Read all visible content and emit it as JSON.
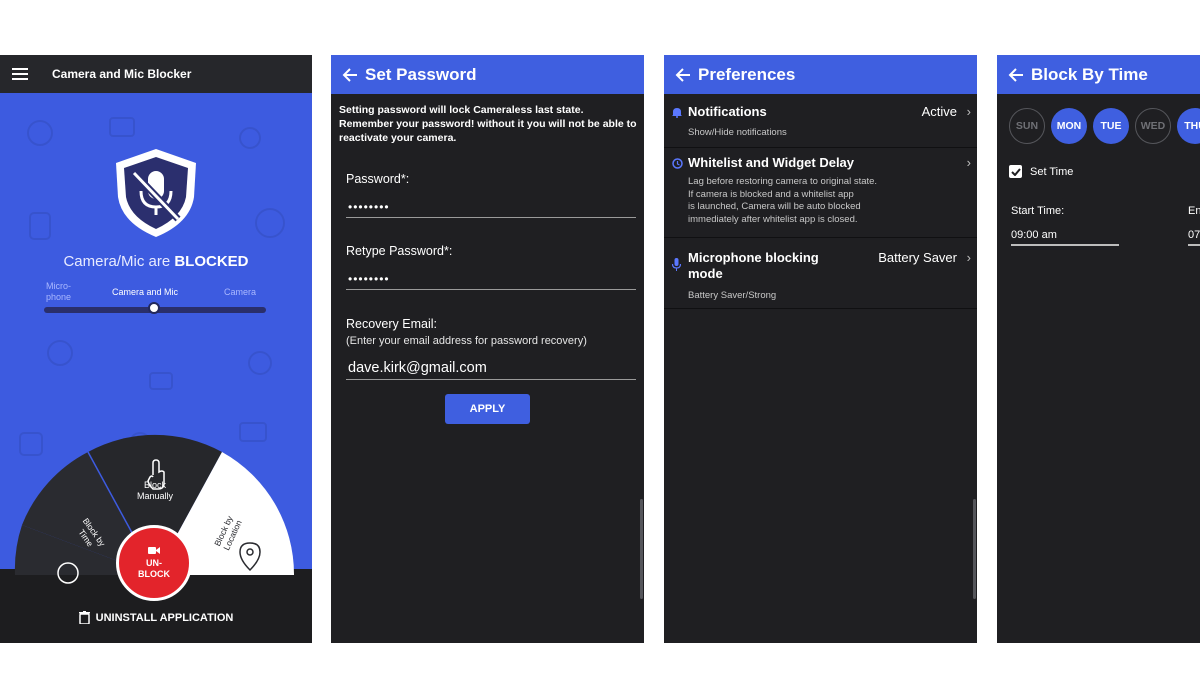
{
  "screen1": {
    "title": "Camera and Mic Blocker",
    "status_prefix": "Camera/Mic are",
    "status_state": "BLOCKED",
    "modes": [
      "Micro-\nphone",
      "Camera and Mic",
      "Camera"
    ],
    "selected_mode": "Camera and Mic",
    "wheel": {
      "block_manually": "Block\nManually",
      "block_by_time": "Block by\nTime",
      "block_by_location": "Block by\nLocation"
    },
    "unblock_label": "UN-\nBLOCK",
    "uninstall_label": "UNINSTALL APPLICATION",
    "colors": {
      "accent": "#3d5be0",
      "danger": "#e3242b",
      "dark": "#26272b"
    }
  },
  "screen2": {
    "title": "Set Password",
    "intro": "Setting password will lock Cameraless last state. Remember your password! without it you will not be able to reactivate your camera.",
    "password_label": "Password*:",
    "password_value": "••••••••",
    "retype_label": "Retype Password*:",
    "retype_value": "••••••••",
    "email_label": "Recovery Email:",
    "email_hint": "(Enter your email address for password recovery)",
    "email_value": "dave.kirk@gmail.com",
    "apply_label": "APPLY"
  },
  "screen3": {
    "title": "Preferences",
    "items": [
      {
        "title": "Notifications",
        "desc": "Show/Hide notifications",
        "value": "Active",
        "icon": "bell-icon"
      },
      {
        "title": "Whitelist and Widget Delay",
        "desc": "Lag before restoring camera to original state.\nIf camera is blocked and a whitelist app\nis launched, Camera will be auto blocked\nimmediately after whitelist app is closed.",
        "value": "",
        "icon": "clock-icon"
      },
      {
        "title": "Microphone blocking\nmode",
        "desc": "Battery Saver/Strong",
        "value": "Battery Saver",
        "icon": "mic-icon"
      }
    ]
  },
  "screen4": {
    "title": "Block By Time",
    "days": [
      {
        "label": "SUN",
        "active": false
      },
      {
        "label": "MON",
        "active": true
      },
      {
        "label": "TUE",
        "active": true
      },
      {
        "label": "WED",
        "active": false
      },
      {
        "label": "THU",
        "active": true
      }
    ],
    "set_time_label": "Set Time",
    "set_time_checked": true,
    "start_label": "Start Time:",
    "start_value": "09:00 am",
    "end_label": "En",
    "end_value": "07"
  }
}
